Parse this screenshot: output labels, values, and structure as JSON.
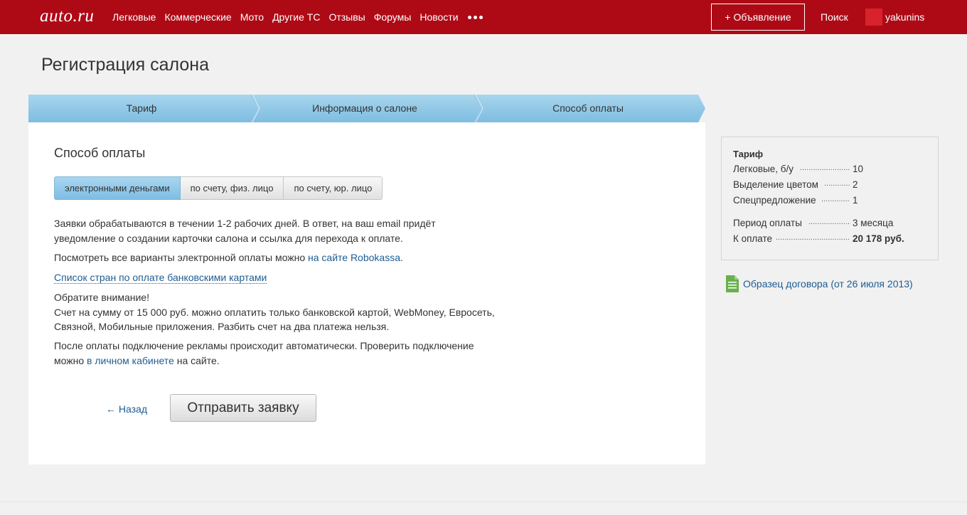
{
  "header": {
    "logo": "auto.ru",
    "nav": [
      "Легковые",
      "Коммерческие",
      "Мото",
      "Другие ТС",
      "Отзывы",
      "Форумы",
      "Новости"
    ],
    "add_button": "+ Объявление",
    "search": "Поиск",
    "username": "yakunins",
    "brand_color": "#ae0a16"
  },
  "page": {
    "title": "Регистрация салона"
  },
  "steps": [
    "Тариф",
    "Информация о салоне",
    "Способ оплаты"
  ],
  "main": {
    "section_title": "Способ оплаты",
    "tabs": [
      "электронными деньгами",
      "по счету, физ. лицо",
      "по счету, юр. лицо"
    ],
    "active_tab": "электронными деньгами",
    "p1_line1": "Заявки обрабатываются в течении 1-2 рабочих дней. В ответ, на ваш email придёт",
    "p1_line2": "уведомление о создании карточки салона и ссылка для перехода к оплате.",
    "p2_text": "Посмотреть все варианты электронной оплаты можно ",
    "p2_link": "на сайте Robokassa",
    "p2_end": ".",
    "countries_link": "Список стран по оплате банковскими картами",
    "notice_title": "Обратите внимание!",
    "notice_line1": "Счет на сумму от 15 000 руб. можно оплатить только банковской картой, WebMoney, Евросеть,",
    "notice_line2": "Связной, Мобильные приложения. Разбить счет на два платежа нельзя.",
    "p4_line1": "После оплаты подключение рекламы происходит автоматически. Проверить подключение",
    "p4_text": "можно ",
    "p4_link": "в личном кабинете",
    "p4_end": " на сайте.",
    "back_link": "← Назад",
    "submit_button": "Отправить заявку"
  },
  "sidebar": {
    "title": "Тариф",
    "rows": [
      {
        "label": "Легковые, б/у",
        "value": "10"
      },
      {
        "label": "Выделение цветом",
        "value": "2"
      },
      {
        "label": "Спецпредложение",
        "value": "1"
      },
      {
        "label": "Период оплаты",
        "value": "3 месяца"
      },
      {
        "label": "К оплате",
        "value": "20 178 руб."
      }
    ],
    "contract_link": "Образец договора (от 26 июля 2013)"
  }
}
